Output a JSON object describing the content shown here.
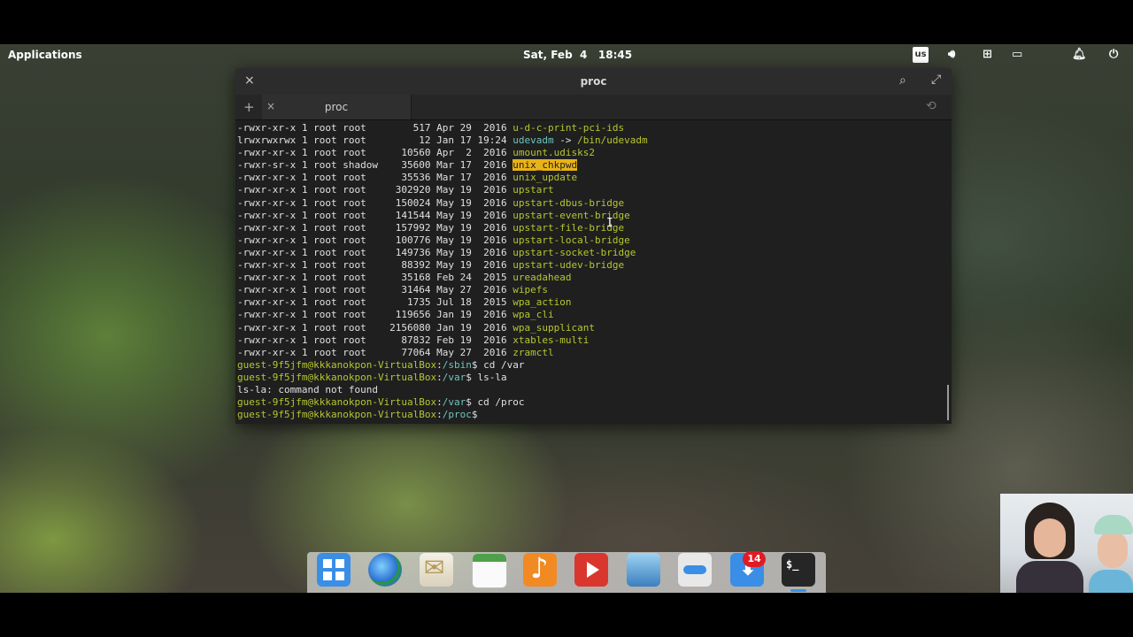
{
  "panel": {
    "applications_label": "Applications",
    "clock": "Sat, Feb  4   18:45",
    "keyboard_layout": "us",
    "icons": [
      "volume-icon",
      "network-icon",
      "battery-icon",
      "notifications-icon",
      "power-icon"
    ]
  },
  "window": {
    "title": "proc",
    "tab_label": "proc",
    "close_glyph": "×",
    "add_tab_glyph": "+",
    "tab_close_glyph": "×"
  },
  "terminal": {
    "listing": [
      {
        "perms": "-rwxr-xr-x",
        "links": "1",
        "owner": "root",
        "group": "root",
        "size": "517",
        "month": "Apr",
        "day": "29",
        "time": "2016",
        "name": "u-d-c-print-pci-ids",
        "kind": "exe"
      },
      {
        "perms": "lrwxrwxrwx",
        "links": "1",
        "owner": "root",
        "group": "root",
        "size": "12",
        "month": "Jan",
        "day": "17",
        "time": "19:24",
        "name": "udevadm",
        "kind": "lnk",
        "target": "/bin/udevadm"
      },
      {
        "perms": "-rwxr-xr-x",
        "links": "1",
        "owner": "root",
        "group": "root",
        "size": "10560",
        "month": "Apr",
        "day": "2",
        "time": "2016",
        "name": "umount.udisks2",
        "kind": "exe"
      },
      {
        "perms": "-rwxr-sr-x",
        "links": "1",
        "owner": "root",
        "group": "shadow",
        "size": "35600",
        "month": "Mar",
        "day": "17",
        "time": "2016",
        "name": "unix_chkpwd",
        "kind": "suid"
      },
      {
        "perms": "-rwxr-xr-x",
        "links": "1",
        "owner": "root",
        "group": "root",
        "size": "35536",
        "month": "Mar",
        "day": "17",
        "time": "2016",
        "name": "unix_update",
        "kind": "exe"
      },
      {
        "perms": "-rwxr-xr-x",
        "links": "1",
        "owner": "root",
        "group": "root",
        "size": "302920",
        "month": "May",
        "day": "19",
        "time": "2016",
        "name": "upstart",
        "kind": "exe"
      },
      {
        "perms": "-rwxr-xr-x",
        "links": "1",
        "owner": "root",
        "group": "root",
        "size": "150024",
        "month": "May",
        "day": "19",
        "time": "2016",
        "name": "upstart-dbus-bridge",
        "kind": "exe"
      },
      {
        "perms": "-rwxr-xr-x",
        "links": "1",
        "owner": "root",
        "group": "root",
        "size": "141544",
        "month": "May",
        "day": "19",
        "time": "2016",
        "name": "upstart-event-bridge",
        "kind": "exe"
      },
      {
        "perms": "-rwxr-xr-x",
        "links": "1",
        "owner": "root",
        "group": "root",
        "size": "157992",
        "month": "May",
        "day": "19",
        "time": "2016",
        "name": "upstart-file-bridge",
        "kind": "exe"
      },
      {
        "perms": "-rwxr-xr-x",
        "links": "1",
        "owner": "root",
        "group": "root",
        "size": "100776",
        "month": "May",
        "day": "19",
        "time": "2016",
        "name": "upstart-local-bridge",
        "kind": "exe"
      },
      {
        "perms": "-rwxr-xr-x",
        "links": "1",
        "owner": "root",
        "group": "root",
        "size": "149736",
        "month": "May",
        "day": "19",
        "time": "2016",
        "name": "upstart-socket-bridge",
        "kind": "exe"
      },
      {
        "perms": "-rwxr-xr-x",
        "links": "1",
        "owner": "root",
        "group": "root",
        "size": "88392",
        "month": "May",
        "day": "19",
        "time": "2016",
        "name": "upstart-udev-bridge",
        "kind": "exe"
      },
      {
        "perms": "-rwxr-xr-x",
        "links": "1",
        "owner": "root",
        "group": "root",
        "size": "35168",
        "month": "Feb",
        "day": "24",
        "time": "2015",
        "name": "ureadahead",
        "kind": "exe"
      },
      {
        "perms": "-rwxr-xr-x",
        "links": "1",
        "owner": "root",
        "group": "root",
        "size": "31464",
        "month": "May",
        "day": "27",
        "time": "2016",
        "name": "wipefs",
        "kind": "exe"
      },
      {
        "perms": "-rwxr-xr-x",
        "links": "1",
        "owner": "root",
        "group": "root",
        "size": "1735",
        "month": "Jul",
        "day": "18",
        "time": "2015",
        "name": "wpa_action",
        "kind": "exe"
      },
      {
        "perms": "-rwxr-xr-x",
        "links": "1",
        "owner": "root",
        "group": "root",
        "size": "119656",
        "month": "Jan",
        "day": "19",
        "time": "2016",
        "name": "wpa_cli",
        "kind": "exe"
      },
      {
        "perms": "-rwxr-xr-x",
        "links": "1",
        "owner": "root",
        "group": "root",
        "size": "2156080",
        "month": "Jan",
        "day": "19",
        "time": "2016",
        "name": "wpa_supplicant",
        "kind": "exe"
      },
      {
        "perms": "-rwxr-xr-x",
        "links": "1",
        "owner": "root",
        "group": "root",
        "size": "87832",
        "month": "Feb",
        "day": "19",
        "time": "2016",
        "name": "xtables-multi",
        "kind": "exe"
      },
      {
        "perms": "-rwxr-xr-x",
        "links": "1",
        "owner": "root",
        "group": "root",
        "size": "77064",
        "month": "May",
        "day": "27",
        "time": "2016",
        "name": "zramctl",
        "kind": "exe"
      }
    ],
    "session": [
      {
        "type": "prompt",
        "user": "guest-9f5jfm@kkkanokpon-VirtualBox",
        "cwd": "/sbin",
        "cmd": " cd /var"
      },
      {
        "type": "prompt",
        "user": "guest-9f5jfm@kkkanokpon-VirtualBox",
        "cwd": "/var",
        "cmd": " ls-la"
      },
      {
        "type": "output",
        "text": "ls-la: command not found"
      },
      {
        "type": "prompt",
        "user": "guest-9f5jfm@kkkanokpon-VirtualBox",
        "cwd": "/var",
        "cmd": " cd /proc"
      },
      {
        "type": "prompt",
        "user": "guest-9f5jfm@kkkanokpon-VirtualBox",
        "cwd": "/proc",
        "cmd": ""
      }
    ]
  },
  "dock": {
    "items": [
      "Multitasking View",
      "Web Browser",
      "Mail",
      "Calendar",
      "Music",
      "Videos",
      "Photos",
      "System Settings",
      "AppCenter",
      "Terminal"
    ],
    "appcenter_badge": "14",
    "terminal_glyph": "$_"
  },
  "colors": {
    "exe": "#b6c630",
    "link": "#6fc4bd",
    "suid_bg": "#e8b316",
    "terminal_bg": "#1f1f1f"
  }
}
